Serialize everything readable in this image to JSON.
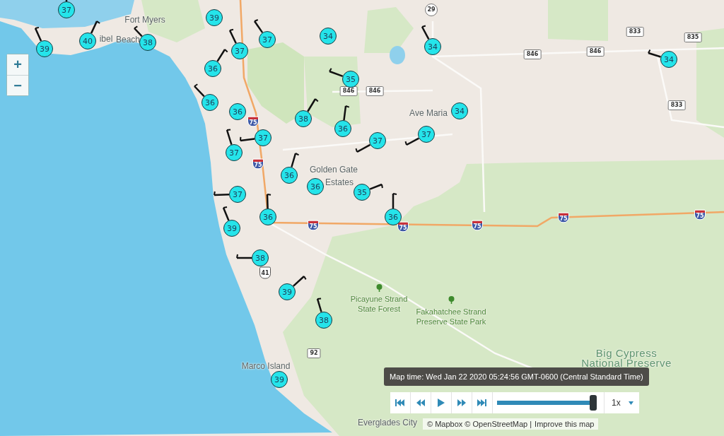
{
  "zoom_controls": [
    {
      "label": "+"
    },
    {
      "label": "−"
    }
  ],
  "stations": [
    {
      "reading": "37"
    },
    {
      "reading": "39"
    },
    {
      "reading": "40"
    },
    {
      "reading": "38"
    },
    {
      "reading": "39"
    },
    {
      "reading": "37"
    },
    {
      "reading": "37"
    },
    {
      "reading": "34"
    },
    {
      "reading": "36"
    },
    {
      "reading": "35"
    },
    {
      "reading": "36"
    },
    {
      "reading": "36"
    },
    {
      "reading": "38"
    },
    {
      "reading": "36"
    },
    {
      "reading": "37"
    },
    {
      "reading": "37"
    },
    {
      "reading": "37"
    },
    {
      "reading": "37"
    },
    {
      "reading": "34"
    },
    {
      "reading": "34"
    },
    {
      "reading": "34"
    },
    {
      "reading": "36"
    },
    {
      "reading": "36"
    },
    {
      "reading": "35"
    },
    {
      "reading": "37"
    },
    {
      "reading": "39"
    },
    {
      "reading": "36"
    },
    {
      "reading": "36"
    },
    {
      "reading": "38"
    },
    {
      "reading": "39"
    },
    {
      "reading": "38"
    },
    {
      "reading": "39"
    }
  ],
  "place_labels": [
    {
      "text": "Fort Myers",
      "kind": "town"
    },
    {
      "text": "ibel",
      "kind": "town"
    },
    {
      "text": "Beach",
      "kind": "town"
    },
    {
      "text": "Ave Maria",
      "kind": "town"
    },
    {
      "text": "Golden Gate",
      "kind": "town"
    },
    {
      "text": "Estates",
      "kind": "town"
    },
    {
      "text": "Picayune Strand",
      "kind": "park"
    },
    {
      "text": "State Forest",
      "kind": "park"
    },
    {
      "text": "Fakahatchee Strand",
      "kind": "park"
    },
    {
      "text": "Preserve State Park",
      "kind": "park"
    },
    {
      "text": "Big Cypress",
      "kind": "region"
    },
    {
      "text": "Marco Island",
      "kind": "town"
    },
    {
      "text": "National Preserve",
      "kind": "region"
    },
    {
      "text": "Everglades City",
      "kind": "town"
    }
  ],
  "road_shields": [
    {
      "label": "29",
      "kind": "state"
    },
    {
      "label": "833",
      "kind": "county"
    },
    {
      "label": "835",
      "kind": "county"
    },
    {
      "label": "846",
      "kind": "county"
    },
    {
      "label": "846",
      "kind": "county"
    },
    {
      "label": "846",
      "kind": "county"
    },
    {
      "label": "846",
      "kind": "county"
    },
    {
      "label": "833",
      "kind": "county"
    },
    {
      "label": "75",
      "kind": "interstate"
    },
    {
      "label": "75",
      "kind": "interstate"
    },
    {
      "label": "75",
      "kind": "interstate"
    },
    {
      "label": "75",
      "kind": "interstate"
    },
    {
      "label": "75",
      "kind": "interstate"
    },
    {
      "label": "75",
      "kind": "interstate"
    },
    {
      "label": "75",
      "kind": "interstate"
    },
    {
      "label": "41",
      "kind": "us"
    },
    {
      "label": "92",
      "kind": "county"
    }
  ],
  "time_display": "Map time: Wed Jan 22 2020 05:24:56 GMT-0600 (Central Standard Time)",
  "playback": {
    "buttons": [
      {
        "kind": "first"
      },
      {
        "kind": "back"
      },
      {
        "kind": "play"
      },
      {
        "kind": "forward"
      },
      {
        "kind": "last"
      }
    ],
    "level": 1.0,
    "speed": "1x"
  },
  "attribution": {
    "text": "© Mapbox © OpenStreetMap |",
    "link": "Improve this map"
  }
}
